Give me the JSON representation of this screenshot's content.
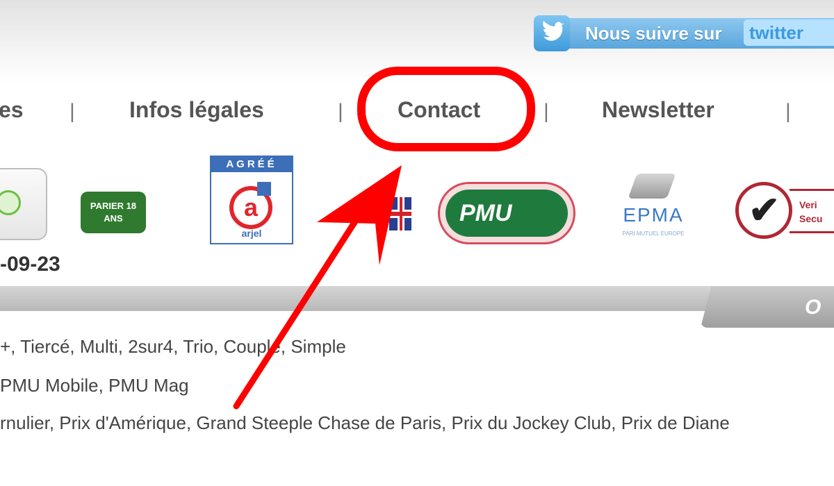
{
  "twitter": {
    "text": "Nous suivre sur",
    "logo_text": "twitter",
    "color": "#5aa6dc"
  },
  "nav": {
    "items": [
      {
        "label": "es"
      },
      {
        "label": "Infos légales"
      },
      {
        "label": "Contact"
      },
      {
        "label": "Newsletter"
      }
    ],
    "separator": "|"
  },
  "logos": {
    "parier": "PARIER 18 ANS",
    "arjel_head": "AGRÉÉ",
    "arjel_mark": "a",
    "arjel_name": "arjel",
    "pmu": "PMU",
    "epma": "EPMA",
    "epma_sub": "PARI MUTUEL EUROPE",
    "verif": "Veri Secu"
  },
  "date_fragment": "-09-23",
  "tab_label": "O",
  "content_lines": [
    "+, Tiercé, Multi, 2sur4, Trio, Couplé, Simple",
    "PMU Mobile, PMU Mag",
    "rnulier, Prix d'Amérique, Grand Steeple Chase de Paris, Prix du Jockey Club, Prix de Diane"
  ],
  "colors": {
    "highlight_red": "#ff0000",
    "pmu_green": "#1f7a3e",
    "arjel_blue": "#3d6fb8"
  }
}
